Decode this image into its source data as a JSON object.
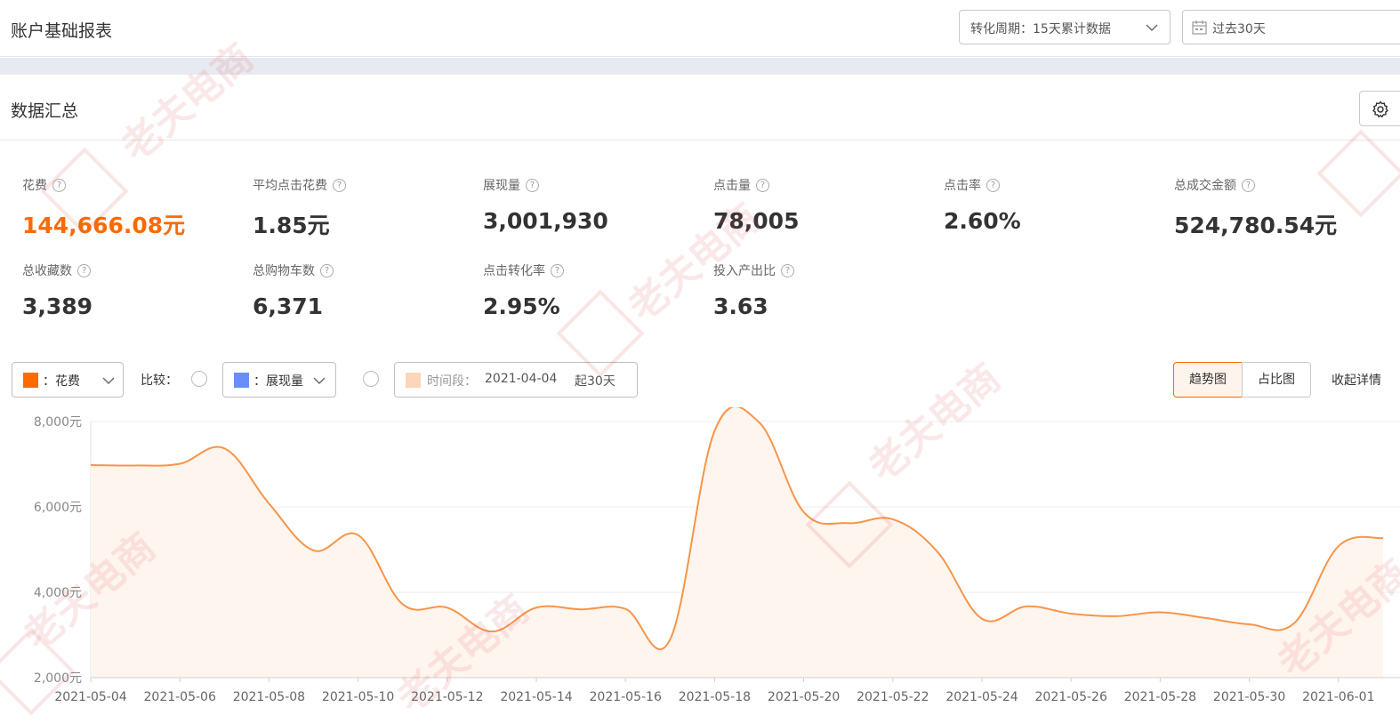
{
  "header": {
    "title": "账户基础报表",
    "period_select": "转化周期：15天累计数据",
    "date_range": "过去30天"
  },
  "summary": {
    "title": "数据汇总",
    "metrics_row1": [
      {
        "label": "花费",
        "value": "144,666.08元"
      },
      {
        "label": "平均点击花费",
        "value": "1.85元"
      },
      {
        "label": "展现量",
        "value": "3,001,930"
      },
      {
        "label": "点击量",
        "value": "78,005"
      },
      {
        "label": "点击率",
        "value": "2.60%"
      },
      {
        "label": "总成交金额",
        "value": "524,780.54元"
      }
    ],
    "metrics_row2": [
      {
        "label": "总收藏数",
        "value": "3,389"
      },
      {
        "label": "总购物车数",
        "value": "6,371"
      },
      {
        "label": "点击转化率",
        "value": "2.95%"
      },
      {
        "label": "投入产出比",
        "value": "3.63"
      }
    ]
  },
  "controls": {
    "metric1": "：花费",
    "metric1_color": "#ff6a00",
    "compare_label": "比较：",
    "metric2": "：展现量",
    "metric2_color": "#6b8df7",
    "period_label": "时间段：",
    "period_date": "2021-04-04",
    "period_suffix": "起30天",
    "period_color": "#fdd5b8",
    "tab_trend": "趋势图",
    "tab_share": "占比图",
    "collapse": "收起详情"
  },
  "watermark": "老夫电商",
  "chart_data": {
    "type": "area",
    "x": [
      "2021-05-04",
      "2021-05-05",
      "2021-05-06",
      "2021-05-07",
      "2021-05-08",
      "2021-05-09",
      "2021-05-10",
      "2021-05-11",
      "2021-05-12",
      "2021-05-13",
      "2021-05-14",
      "2021-05-15",
      "2021-05-16",
      "2021-05-17",
      "2021-05-18",
      "2021-05-19",
      "2021-05-20",
      "2021-05-21",
      "2021-05-22",
      "2021-05-23",
      "2021-05-24",
      "2021-05-25",
      "2021-05-26",
      "2021-05-27",
      "2021-05-28",
      "2021-05-29",
      "2021-05-30",
      "2021-05-31",
      "2021-06-01"
    ],
    "x_tick_labels": [
      "2021-05-04",
      "2021-05-06",
      "2021-05-08",
      "2021-05-10",
      "2021-05-12",
      "2021-05-14",
      "2021-05-16",
      "2021-05-18",
      "2021-05-20",
      "2021-05-22",
      "2021-05-24",
      "2021-05-26",
      "2021-05-28",
      "2021-05-30",
      "2021-06-01"
    ],
    "series": [
      {
        "name": "花费",
        "color": "#f7954a",
        "values": [
          6980,
          6970,
          7010,
          7370,
          6080,
          4980,
          5340,
          3720,
          3640,
          3080,
          3640,
          3600,
          3610,
          2890,
          7780,
          7980,
          5880,
          5620,
          5710,
          4950,
          3380,
          3670,
          3500,
          3440,
          3530,
          3400,
          3250,
          3270,
          5080,
          5270
        ]
      }
    ],
    "y_ticks": [
      "8,000元",
      "6,000元",
      "4,000元",
      "2,000元"
    ],
    "ylim": [
      2000,
      8000
    ],
    "grid": true
  }
}
